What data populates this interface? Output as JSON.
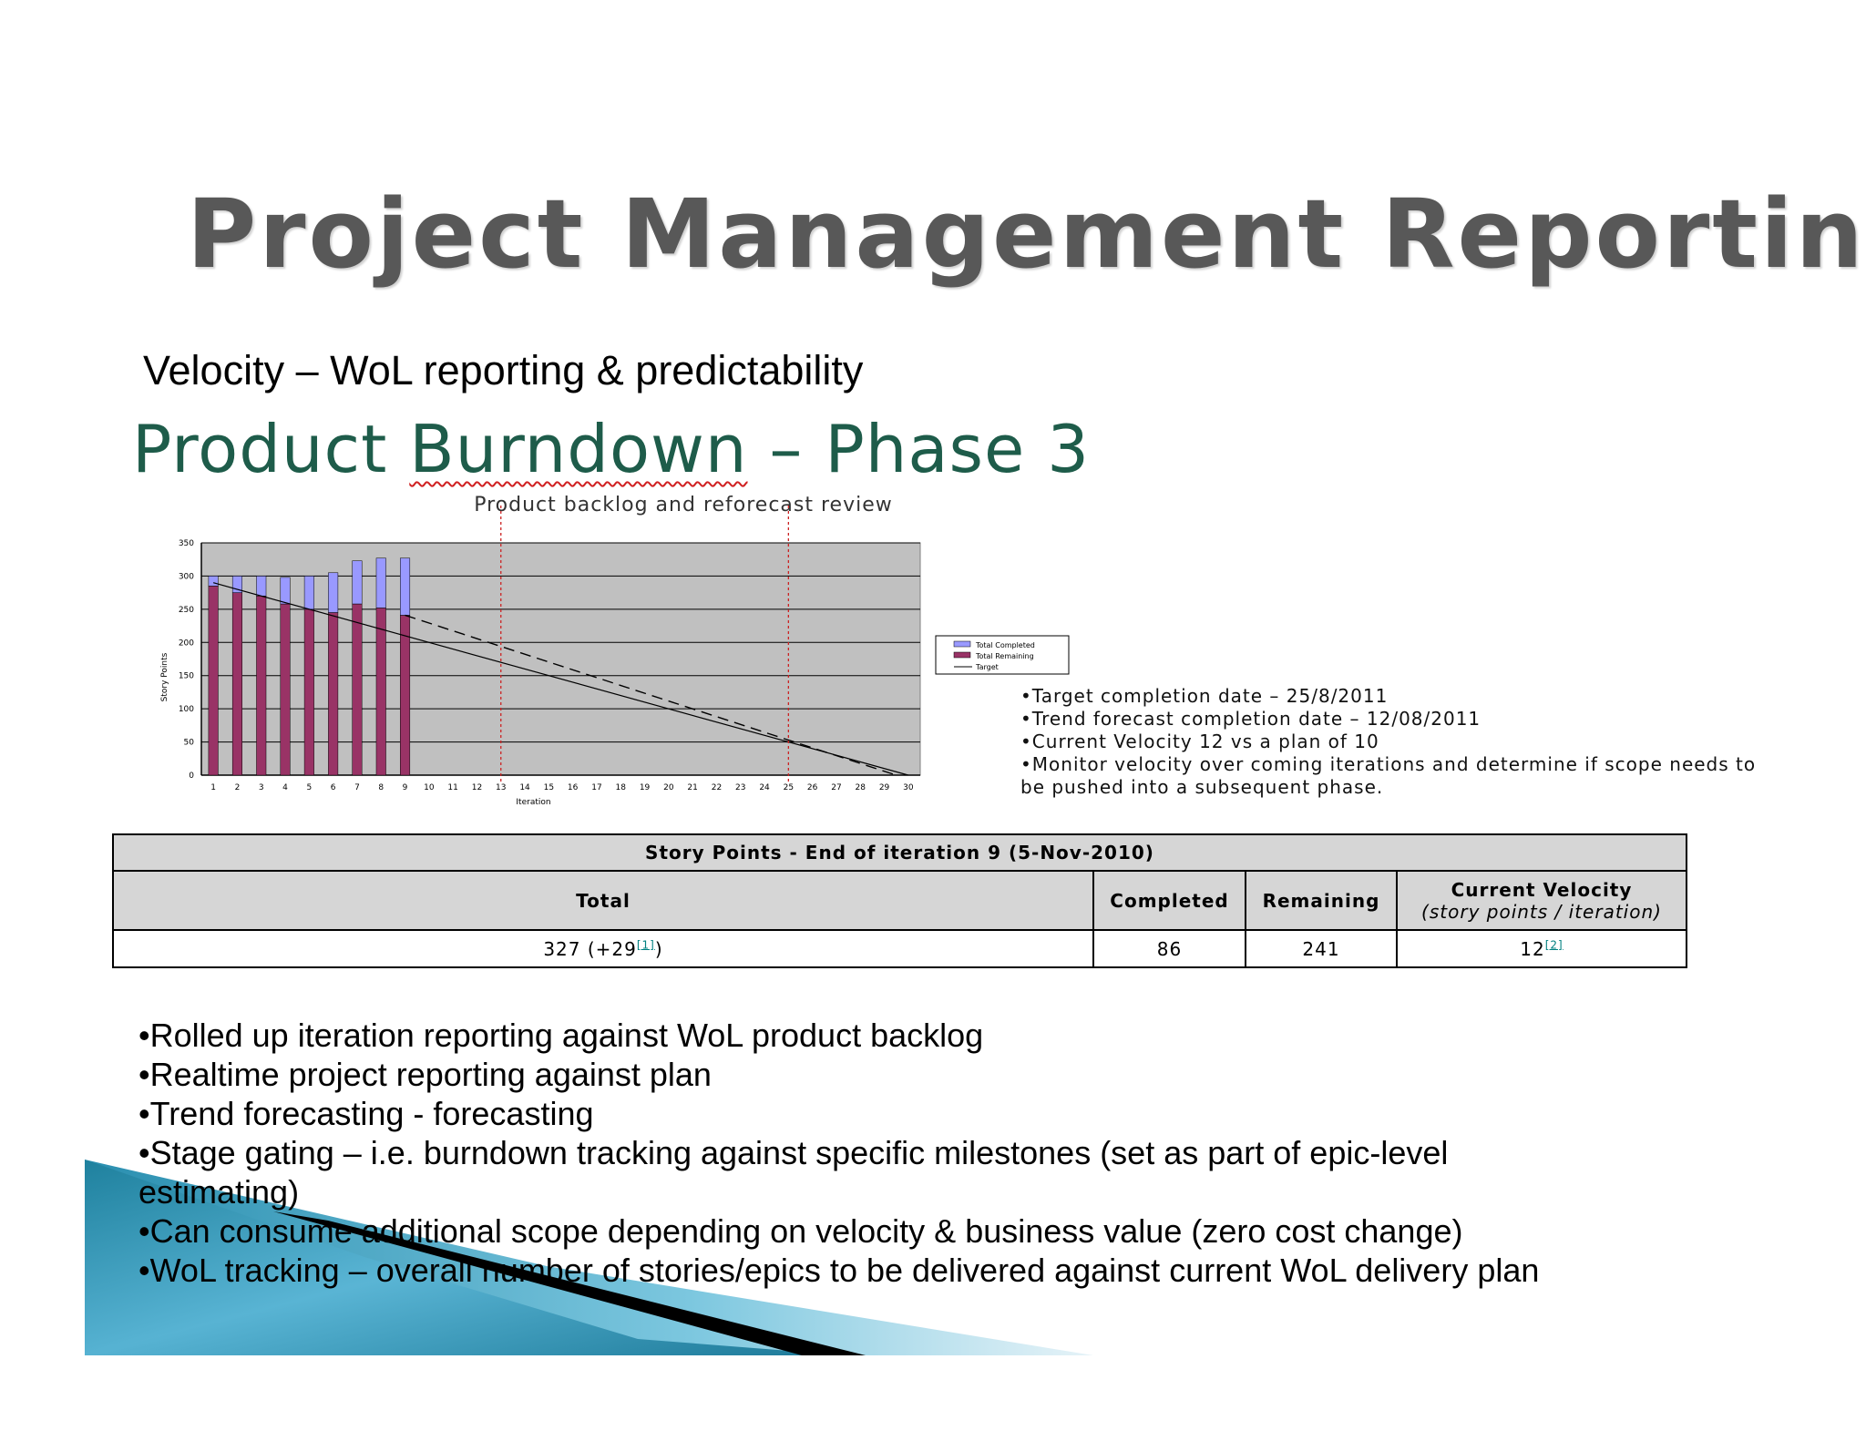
{
  "slide": {
    "title": "Project Management Reporting",
    "subtitle": "Velocity – WoL reporting & predictability",
    "pb_title_prefix": "Product ",
    "pb_title_wavy": "Burndown",
    "pb_title_suffix": " – Phase 3",
    "review_label": "Product backlog and reforecast review"
  },
  "chart_data": {
    "type": "bar",
    "xlabel": "Iteration",
    "ylabel": "Story Points",
    "ylim": [
      0,
      350
    ],
    "yticks": [
      0,
      50,
      100,
      150,
      200,
      250,
      300,
      350
    ],
    "categories": [
      "1",
      "2",
      "3",
      "4",
      "5",
      "6",
      "7",
      "8",
      "9",
      "10",
      "11",
      "12",
      "13",
      "14",
      "15",
      "16",
      "17",
      "18",
      "19",
      "20",
      "21",
      "22",
      "23",
      "24",
      "25",
      "26",
      "27",
      "28",
      "29",
      "30"
    ],
    "series": [
      {
        "name": "Total Completed",
        "kind": "stacked-bar",
        "color": "#9999ff",
        "values": [
          15,
          25,
          30,
          40,
          50,
          60,
          65,
          75,
          86
        ]
      },
      {
        "name": "Total Remaining",
        "kind": "stacked-bar",
        "color": "#993366",
        "values": [
          285,
          275,
          270,
          258,
          250,
          245,
          258,
          252,
          241
        ]
      },
      {
        "name": "Target",
        "kind": "line",
        "color": "#000000",
        "x": [
          1,
          30
        ],
        "y": [
          290,
          0
        ]
      },
      {
        "name": "Trend",
        "kind": "dashed-line",
        "color": "#000000",
        "x": [
          9,
          29.5
        ],
        "y": [
          241,
          0
        ]
      }
    ],
    "markers": [
      13,
      25
    ],
    "legend_position": "right",
    "grid": true
  },
  "notes": [
    "•Target completion date – 25/8/2011",
    "•Trend forecast completion date – 12/08/2011",
    "•Current Velocity 12 vs a plan of 10",
    "•Monitor velocity over coming iterations and determine if scope needs to",
    "be pushed into a subsequent phase."
  ],
  "table": {
    "caption": "Story Points - End of iteration 9 (5-Nov-2010)",
    "headers": {
      "total": "Total",
      "completed": "Completed",
      "remaining": "Remaining",
      "velocity": "Current Velocity",
      "velocity_sub": "(story points / iteration)"
    },
    "row": {
      "total": "327 (+29",
      "total_ref": "[1]",
      "total_close": ")",
      "completed": "86",
      "remaining": "241",
      "velocity": "12",
      "velocity_ref": "[2]"
    }
  },
  "bullets": [
    "•Rolled up iteration reporting against WoL product backlog",
    "•Realtime project reporting against plan",
    "•Trend forecasting - forecasting",
    "•Stage gating – i.e. burndown tracking against specific milestones (set as part of epic-level estimating)",
    "•Can consume additional scope depending on velocity & business value (zero cost change)",
    "•WoL tracking – overall number of stories/epics to be delivered against current WoL delivery plan"
  ]
}
